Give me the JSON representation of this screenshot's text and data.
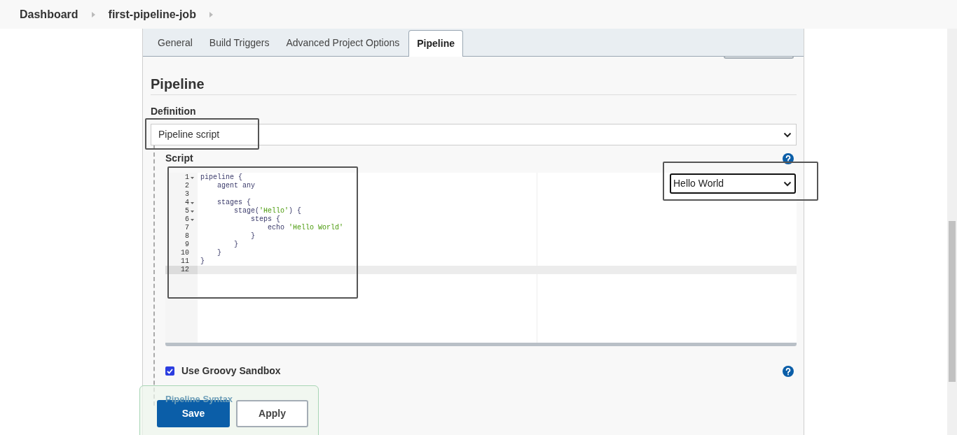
{
  "breadcrumb": [
    {
      "label": "Dashboard"
    },
    {
      "label": "first-pipeline-job"
    }
  ],
  "tabs": [
    {
      "label": "General",
      "selected": false
    },
    {
      "label": "Build Triggers",
      "selected": false
    },
    {
      "label": "Advanced Project Options",
      "selected": false
    },
    {
      "label": "Pipeline",
      "selected": true
    }
  ],
  "section": {
    "title": "Pipeline"
  },
  "definition": {
    "label": "Definition",
    "value": "Pipeline script"
  },
  "script": {
    "label": "Script",
    "sample": "Hello World",
    "lines": [
      {
        "number": "1",
        "fold": true,
        "active": false,
        "segments": [
          {
            "text": "pipeline {",
            "kind": "plain"
          }
        ]
      },
      {
        "number": "2",
        "fold": false,
        "active": false,
        "segments": [
          {
            "text": "    agent any",
            "kind": "plain"
          }
        ]
      },
      {
        "number": "3",
        "fold": false,
        "active": false
      },
      {
        "number": "4",
        "fold": true,
        "active": false,
        "segments": [
          {
            "text": "    stages {",
            "kind": "plain"
          }
        ]
      },
      {
        "number": "5",
        "fold": true,
        "active": false,
        "segments": [
          {
            "text": "        stage(",
            "kind": "plain"
          },
          {
            "text": "'Hello'",
            "kind": "string"
          },
          {
            "text": ") {",
            "kind": "plain"
          }
        ]
      },
      {
        "number": "6",
        "fold": true,
        "active": false,
        "segments": [
          {
            "text": "            steps {",
            "kind": "plain"
          }
        ]
      },
      {
        "number": "7",
        "fold": false,
        "active": false,
        "segments": [
          {
            "text": "                echo ",
            "kind": "plain"
          },
          {
            "text": "'Hello World'",
            "kind": "string"
          }
        ]
      },
      {
        "number": "8",
        "fold": false,
        "active": false,
        "segments": [
          {
            "text": "            }",
            "kind": "plain"
          }
        ]
      },
      {
        "number": "9",
        "fold": false,
        "active": false,
        "segments": [
          {
            "text": "        }",
            "kind": "plain"
          }
        ]
      },
      {
        "number": "10",
        "fold": false,
        "active": false,
        "segments": [
          {
            "text": "    }",
            "kind": "plain"
          }
        ]
      },
      {
        "number": "11",
        "fold": false,
        "active": false,
        "segments": [
          {
            "text": "}",
            "kind": "plain"
          }
        ]
      },
      {
        "number": "12",
        "fold": false,
        "active": true
      }
    ]
  },
  "sandbox": {
    "label": "Use Groovy Sandbox",
    "checked": true
  },
  "syntax_link": "Pipeline Syntax",
  "buttons": [
    {
      "label": "Save",
      "kind": "primary"
    },
    {
      "label": "Apply",
      "kind": "secondary"
    }
  ]
}
